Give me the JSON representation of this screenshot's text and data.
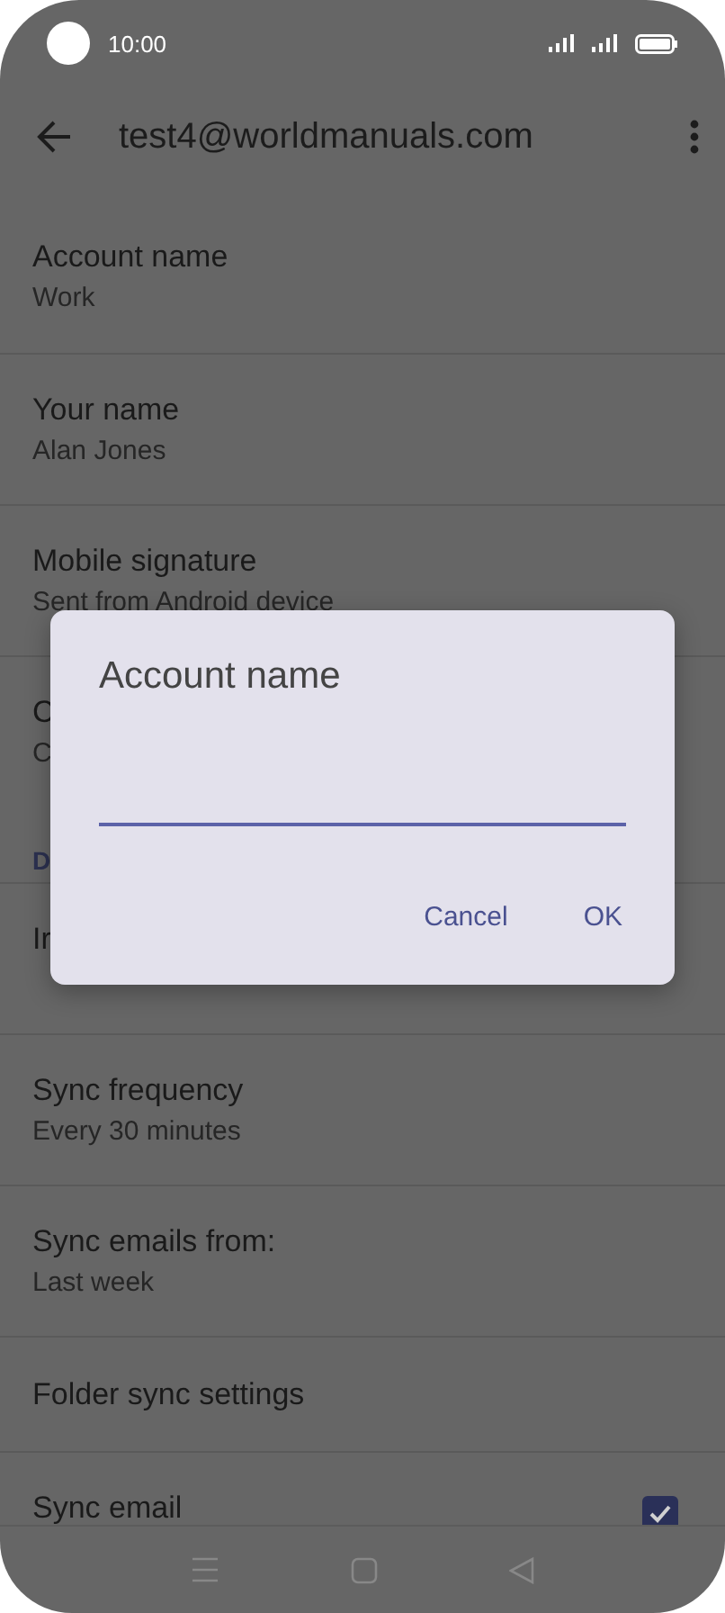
{
  "status_bar": {
    "time": "10:00"
  },
  "app_bar": {
    "title": "test4@worldmanuals.com"
  },
  "settings": [
    {
      "kind": "item",
      "title": "Account name",
      "subtitle": "Work"
    },
    {
      "kind": "item",
      "title": "Your name",
      "subtitle": "Alan Jones"
    },
    {
      "kind": "item",
      "title": "Mobile signature",
      "subtitle": "Sent from Android device"
    },
    {
      "kind": "item",
      "title": "C",
      "subtitle": "C"
    },
    {
      "kind": "header",
      "title": "D"
    },
    {
      "kind": "item",
      "title": "Ir"
    },
    {
      "kind": "item",
      "title": "Sync frequency",
      "subtitle": "Every 30 minutes"
    },
    {
      "kind": "item",
      "title": "Sync emails from:",
      "subtitle": "Last week"
    },
    {
      "kind": "row",
      "title": "Folder sync settings"
    },
    {
      "kind": "checkbox",
      "title": "Sync email",
      "checked": true
    }
  ],
  "dialog": {
    "title": "Account name",
    "buttons": [
      "Cancel",
      "OK"
    ]
  }
}
